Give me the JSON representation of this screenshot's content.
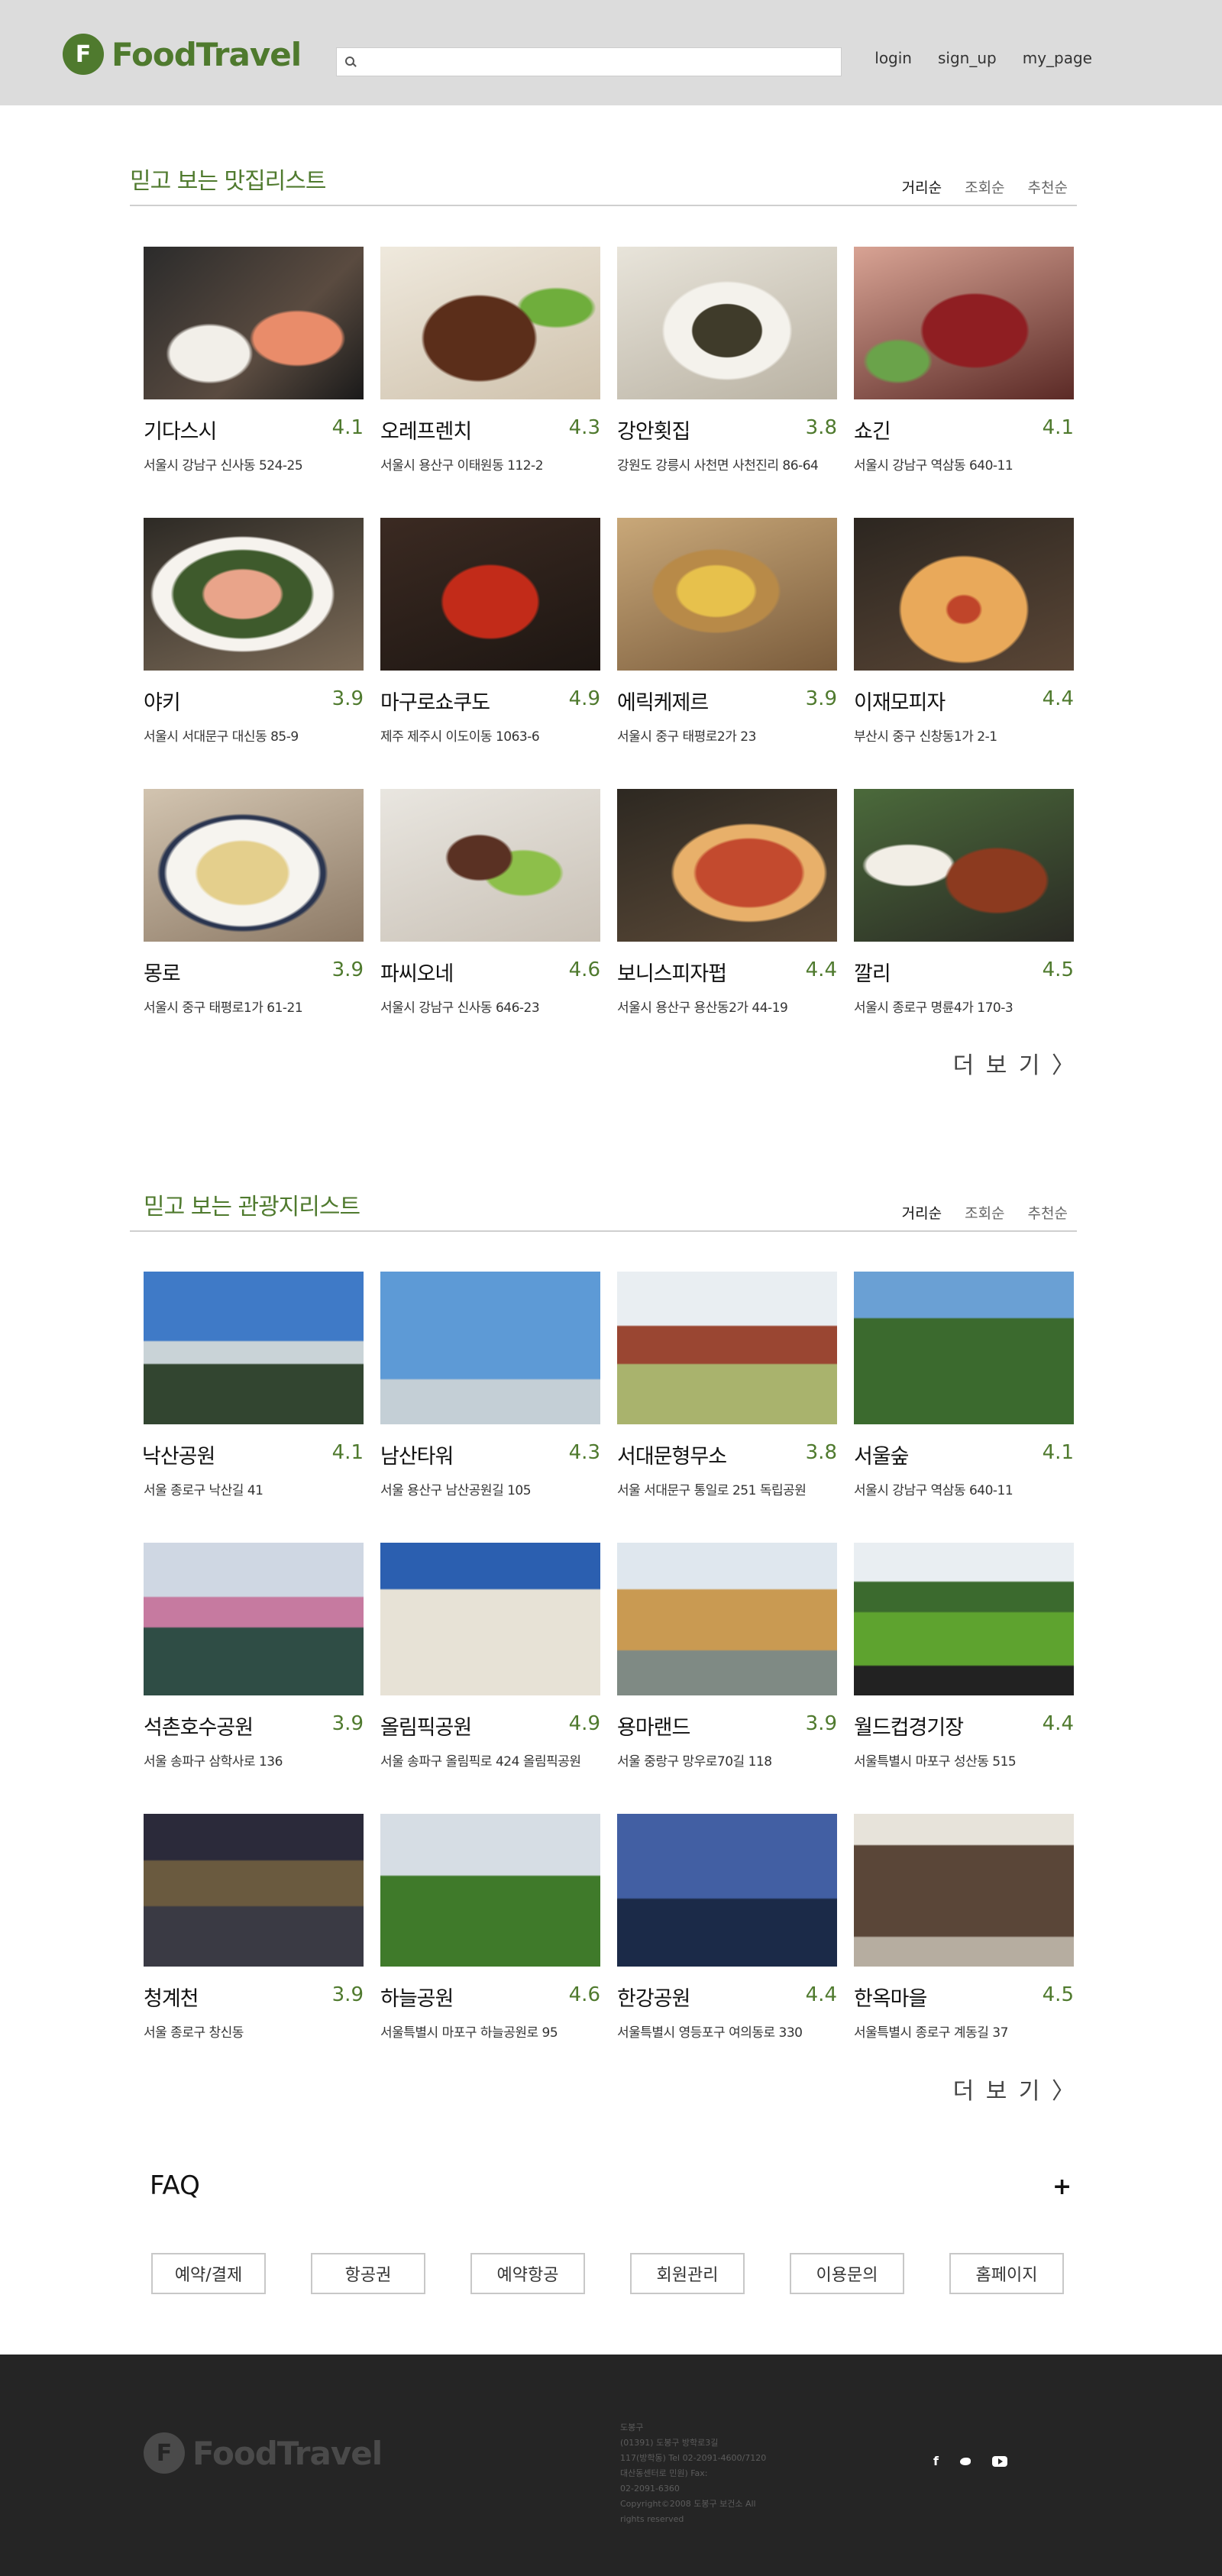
{
  "header": {
    "logo_text": "FoodTravel",
    "logo_mark": "F",
    "search_placeholder": "",
    "nav": [
      "login",
      "sign_up",
      "my_page"
    ]
  },
  "colors": {
    "brand": "#4f7a2e",
    "header_bg": "#dcdcdc",
    "footer_bg": "#252525"
  },
  "restaurants": {
    "title": "믿고 보는 맛집리스트",
    "sort": [
      "거리순",
      "조회순",
      "추천순"
    ],
    "more": "더 보 기 〉",
    "items": [
      {
        "name": "기다스시",
        "score": "4.1",
        "addr": "서울시 강남구 신사동 524-25"
      },
      {
        "name": "오레프렌치",
        "score": "4.3",
        "addr": "서울시 용산구 이태원동 112-2"
      },
      {
        "name": "강안횟집",
        "score": "3.8",
        "addr": "강원도 강릉시 사천면 사천진리 86-64"
      },
      {
        "name": "쇼긴",
        "score": "4.1",
        "addr": "서울시 강남구 역삼동 640-11"
      },
      {
        "name": "야키",
        "score": "3.9",
        "addr": "서울시 서대문구 대신동 85-9"
      },
      {
        "name": "마구로쇼쿠도",
        "score": "4.9",
        "addr": "제주 제주시 이도이동 1063-6"
      },
      {
        "name": "에릭케제르",
        "score": "3.9",
        "addr": "서울시 중구 태평로2가 23"
      },
      {
        "name": "이재모피자",
        "score": "4.4",
        "addr": "부산시 중구 신창동1가 2-1"
      },
      {
        "name": "몽로",
        "score": "3.9",
        "addr": "서울시 중구 태평로1가 61-21"
      },
      {
        "name": "파씨오네",
        "score": "4.6",
        "addr": "서울시 강남구 신사동 646-23"
      },
      {
        "name": "보니스피자펍",
        "score": "4.4",
        "addr": "서울시 용산구 용산동2가 44-19"
      },
      {
        "name": "깔리",
        "score": "4.5",
        "addr": "서울시 종로구 명륜4가 170-3"
      }
    ]
  },
  "attractions": {
    "title": "믿고 보는 관광지리스트",
    "sort": [
      "거리순",
      "조회순",
      "추천순"
    ],
    "more": "더 보 기 〉",
    "items": [
      {
        "name": "낙산공원",
        "score": "4.1",
        "addr": "서울 종로구 낙산길 41"
      },
      {
        "name": "남산타워",
        "score": "4.3",
        "addr": "서울 용산구 남산공원길 105"
      },
      {
        "name": "서대문형무소",
        "score": "3.8",
        "addr": "서울 서대문구 통일로 251 독립공원"
      },
      {
        "name": "서울숲",
        "score": "4.1",
        "addr": "서울시 강남구 역삼동 640-11"
      },
      {
        "name": "석촌호수공원",
        "score": "3.9",
        "addr": "서울 송파구 삼학사로 136"
      },
      {
        "name": "올림픽공원",
        "score": "4.9",
        "addr": "서울 송파구 올림픽로 424 올림픽공원"
      },
      {
        "name": "용마랜드",
        "score": "3.9",
        "addr": "서울 중랑구 망우로70길 118"
      },
      {
        "name": "월드컵경기장",
        "score": "4.4",
        "addr": "서울특별시 마포구 성산동 515"
      },
      {
        "name": "청계천",
        "score": "3.9",
        "addr": "서울 종로구 창신동"
      },
      {
        "name": "하늘공원",
        "score": "4.6",
        "addr": "서울특별시 마포구 하늘공원로 95"
      },
      {
        "name": "한강공원",
        "score": "4.4",
        "addr": "서울특별시 영등포구 여의동로 330"
      },
      {
        "name": "한옥마을",
        "score": "4.5",
        "addr": "서울특별시 종로구 계동길 37"
      }
    ]
  },
  "faq": {
    "title": "FAQ",
    "toggle": "+",
    "buttons": [
      "예약/결제",
      "항공권",
      "예약항공",
      "회원관리",
      "이용문의",
      "홈페이지"
    ]
  },
  "footer": {
    "logo_text": "FoodTravel",
    "info": [
      "도봉구",
      "(01391) 도봉구 방학로3길",
      "117(방학동) Tel 02-2091-4600/7120",
      "대산동센터로 민원) Fax:",
      "02-2091-6360",
      "Copyright©2008 도봉구 보건소 All",
      "rights reserved"
    ],
    "social": [
      "f",
      "twitter-icon",
      "youtube-icon"
    ]
  }
}
